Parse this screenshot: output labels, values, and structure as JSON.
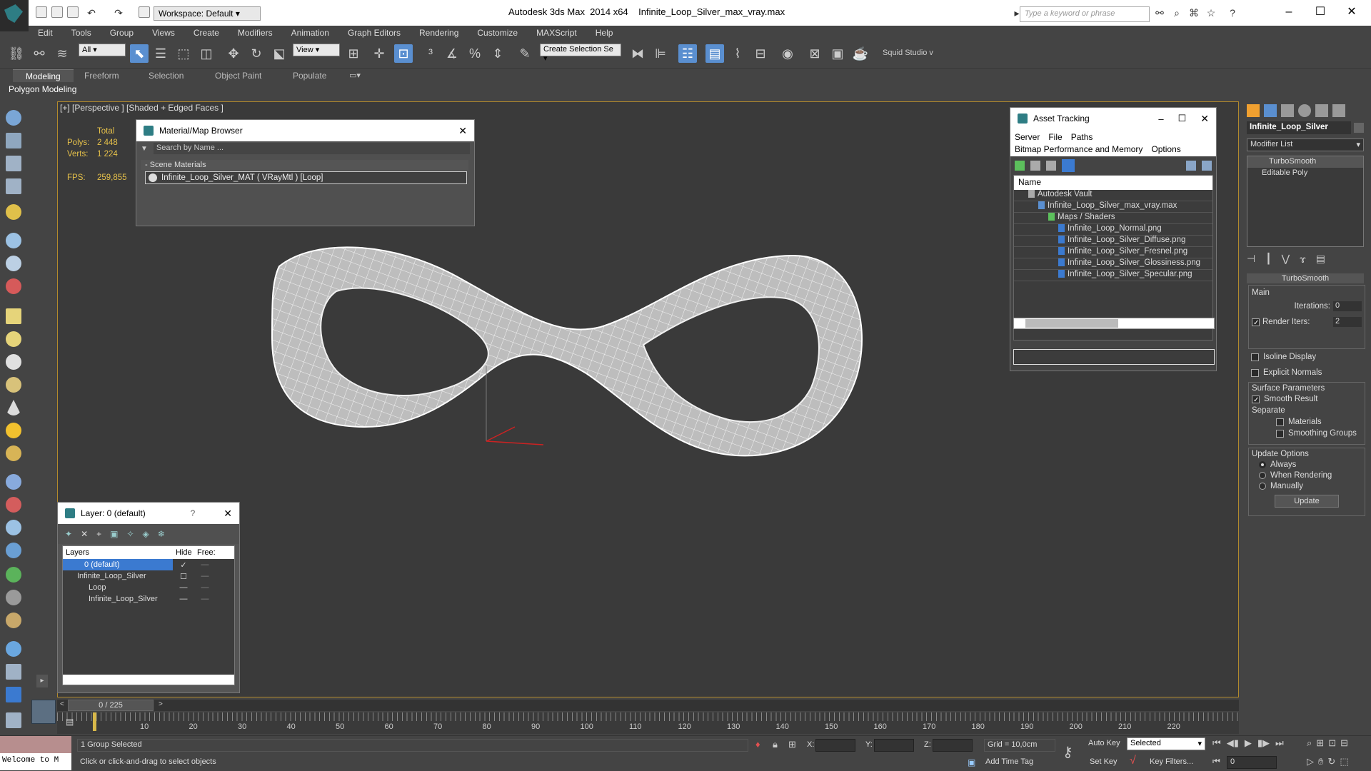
{
  "titlebar": {
    "workspace": "Workspace: Default",
    "app": "Autodesk 3ds Max  2014 x64",
    "file": "Infinite_Loop_Silver_max_vray.max",
    "search_placeholder": "Type a keyword or phrase"
  },
  "menu": [
    "Edit",
    "Tools",
    "Group",
    "Views",
    "Create",
    "Modifiers",
    "Animation",
    "Graph Editors",
    "Rendering",
    "Customize",
    "MAXScript",
    "Help"
  ],
  "toolbar": {
    "filter": "All",
    "refcoord": "View",
    "selection_set": "Create Selection Se",
    "squid": "Squid Studio v"
  },
  "ribbon": {
    "tabs": [
      "Modeling",
      "Freeform",
      "Selection",
      "Object Paint",
      "Populate"
    ],
    "panel": "Polygon Modeling"
  },
  "viewport": {
    "label": "[+] [Perspective ] [Shaded + Edged Faces ]",
    "total_label": "Total",
    "polys_label": "Polys:",
    "polys": "2 448",
    "verts_label": "Verts:",
    "verts": "1 224",
    "fps_label": "FPS:",
    "fps": "259,855"
  },
  "material_browser": {
    "title": "Material/Map Browser",
    "search_placeholder": "Search by Name ...",
    "section": "- Scene Materials",
    "item": "Infinite_Loop_Silver_MAT ( VRayMtl ) [Loop]"
  },
  "asset_tracking": {
    "title": "Asset Tracking",
    "menu": [
      "Server",
      "File",
      "Paths"
    ],
    "menu2": [
      "Bitmap Performance and Memory",
      "Options"
    ],
    "column": "Name",
    "rows": [
      {
        "text": "Autodesk Vault",
        "indent": 0
      },
      {
        "text": "Infinite_Loop_Silver_max_vray.max",
        "indent": 1
      },
      {
        "text": "Maps / Shaders",
        "indent": 2
      },
      {
        "text": "Infinite_Loop_Normal.png",
        "indent": 3
      },
      {
        "text": "Infinite_Loop_Silver_Diffuse.png",
        "indent": 3
      },
      {
        "text": "Infinite_Loop_Silver_Fresnel.png",
        "indent": 3
      },
      {
        "text": "Infinite_Loop_Silver_Glossiness.png",
        "indent": 3
      },
      {
        "text": "Infinite_Loop_Silver_Specular.png",
        "indent": 3
      }
    ]
  },
  "layer_window": {
    "title": "Layer: 0 (default)",
    "help": "?",
    "columns": {
      "layers": "Layers",
      "hide": "Hide",
      "freeze": "Free:"
    },
    "rows": [
      {
        "name": "0 (default)",
        "selected": true
      },
      {
        "name": "Infinite_Loop_Silver",
        "selected": false
      },
      {
        "name": "Loop",
        "selected": false
      },
      {
        "name": "Infinite_Loop_Silver",
        "selected": false
      }
    ]
  },
  "command_panel": {
    "object_name": "Infinite_Loop_Silver",
    "modifier_list": "Modifier List",
    "stack": [
      "TurboSmooth",
      "Editable Poly"
    ],
    "rollout": "TurboSmooth",
    "main": "Main",
    "iterations_label": "Iterations:",
    "iterations": "0",
    "render_iters_label": "Render Iters:",
    "render_iters": "2",
    "isoline": "Isoline Display",
    "explicit": "Explicit Normals",
    "surface_params": "Surface Parameters",
    "smooth_result": "Smooth Result",
    "separate": "Separate",
    "materials": "Materials",
    "smoothing_groups": "Smoothing Groups",
    "update_options": "Update Options",
    "always": "Always",
    "when_rendering": "When Rendering",
    "manually": "Manually",
    "update": "Update"
  },
  "timeline": {
    "frame": "0 / 225",
    "ticks": [
      "10",
      "20",
      "30",
      "40",
      "50",
      "60",
      "70",
      "80",
      "90",
      "100",
      "110",
      "120",
      "130",
      "140",
      "150",
      "160",
      "170",
      "180",
      "190",
      "200",
      "210",
      "220"
    ]
  },
  "statusbar": {
    "welcome": "Welcome to M",
    "selected": "1 Group Selected",
    "prompt": "Click or click-and-drag to select objects",
    "x": "X:",
    "y": "Y:",
    "z": "Z:",
    "grid": "Grid = 10,0cm",
    "add_time_tag": "Add Time Tag",
    "auto_key": "Auto Key",
    "set_key": "Set Key",
    "selected_dd": "Selected",
    "key_filters": "Key Filters...",
    "frame_field": "0"
  }
}
